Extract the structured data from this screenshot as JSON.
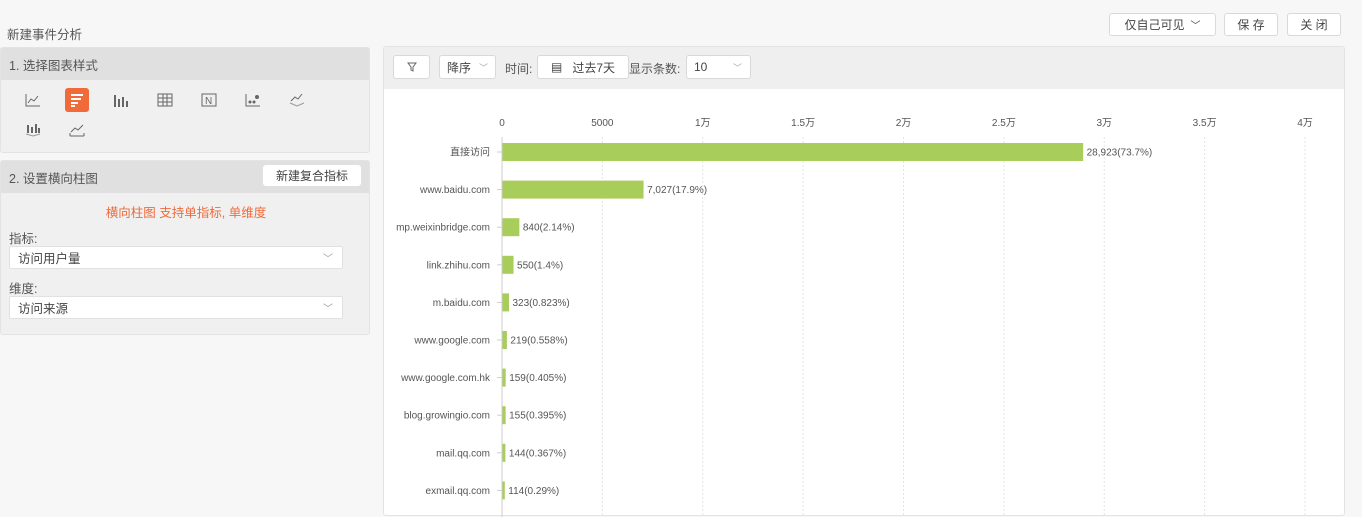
{
  "page_title": "新建事件分析",
  "header": {
    "visibility_label": "仅自己可见",
    "save_label": "保 存",
    "close_label": "关 闭"
  },
  "section1": {
    "title": "1. 选择图表样式",
    "icons": [
      "line-chart",
      "horizontal-bar-chart",
      "bar-chart",
      "table",
      "number",
      "scatter",
      "stacked-line",
      "stacked-bar",
      "area-chart"
    ],
    "selected": "horizontal-bar-chart",
    "accent": "#f06a3a"
  },
  "section2": {
    "title": "2. 设置横向柱图",
    "new_metric_label": "新建复合指标",
    "hint": "横向柱图 支持单指标, 单维度",
    "metric_label": "指标:",
    "metric_value": "访问用户量",
    "dimension_label": "维度:",
    "dimension_value": "访问来源"
  },
  "toolbar": {
    "sort_value": "降序",
    "time_label": "时间:",
    "time_value": "过去7天",
    "count_label": "显示条数:",
    "count_value": "10"
  },
  "chart_data": {
    "type": "bar",
    "orientation": "horizontal",
    "categories": [
      "直接访问",
      "www.baidu.com",
      "mp.weixinbridge.com",
      "link.zhihu.com",
      "m.baidu.com",
      "www.google.com",
      "www.google.com.hk",
      "blog.growingio.com",
      "mail.qq.com",
      "exmail.qq.com"
    ],
    "values": [
      28923,
      7027,
      840,
      550,
      323,
      219,
      159,
      155,
      144,
      114
    ],
    "labels": [
      "28,923(73.7%)",
      "7,027(17.9%)",
      "840(2.14%)",
      "550(1.4%)",
      "323(0.823%)",
      "219(0.558%)",
      "159(0.405%)",
      "155(0.395%)",
      "144(0.367%)",
      "114(0.29%)"
    ],
    "xlim": [
      0,
      40000
    ],
    "ticks": [
      0,
      5000,
      10000,
      15000,
      20000,
      25000,
      30000,
      35000,
      40000
    ],
    "tick_labels": [
      "0",
      "5000",
      "1万",
      "1.5万",
      "2万",
      "2.5万",
      "3万",
      "3.5万",
      "4万"
    ],
    "color": "#a9cd5a",
    "grid": true
  }
}
